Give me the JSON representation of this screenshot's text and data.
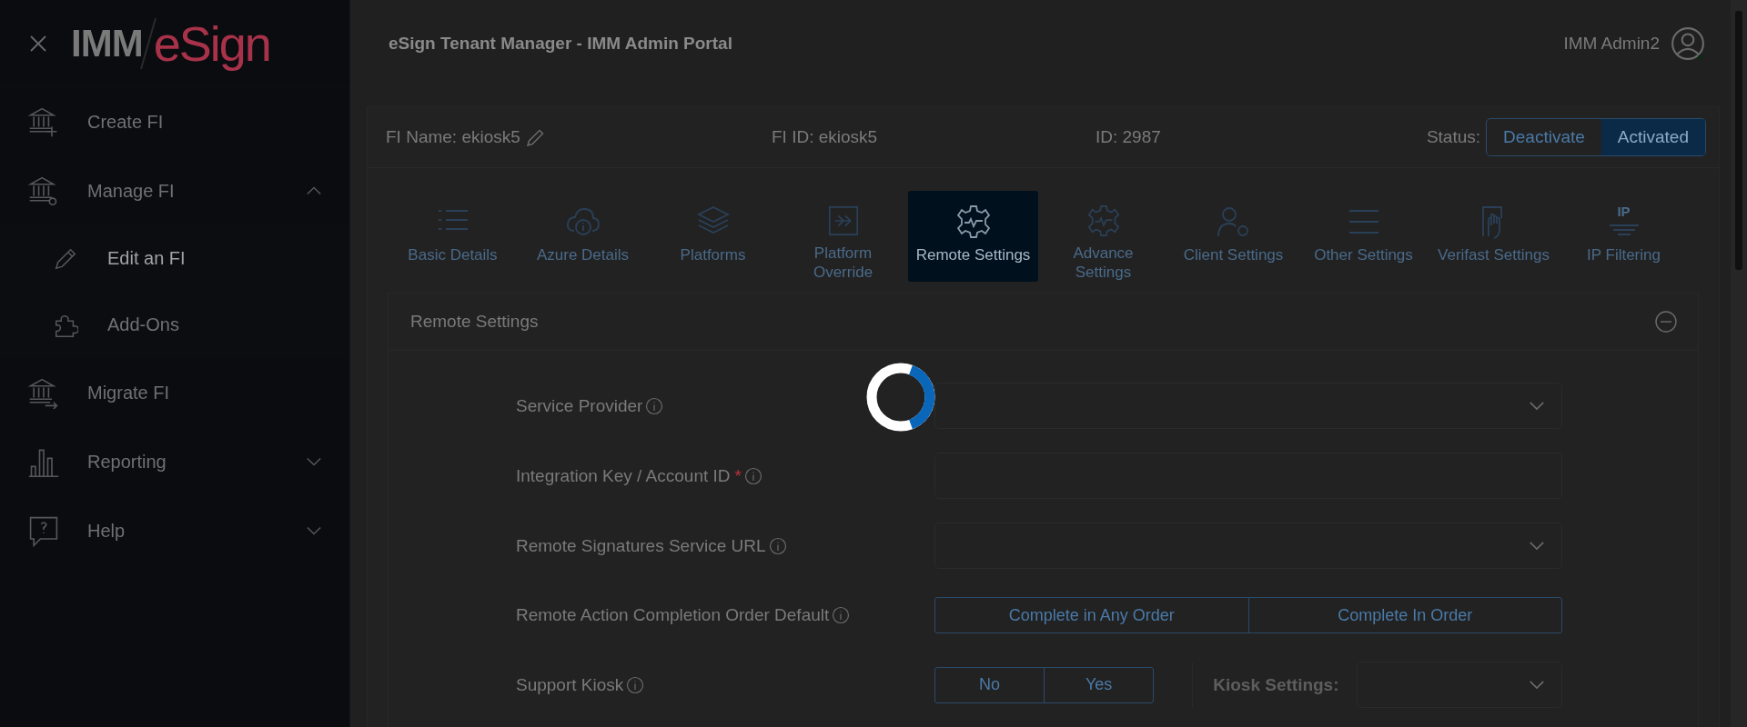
{
  "logo": {
    "left": "IMM",
    "right": "eSign"
  },
  "sidebar": {
    "items": [
      {
        "label": "Create FI",
        "selected": false
      },
      {
        "label": "Manage FI",
        "expanded": true,
        "selected": false,
        "children": [
          {
            "label": "Edit an FI",
            "selected": true
          },
          {
            "label": "Add-Ons",
            "selected": false
          }
        ]
      },
      {
        "label": "Migrate FI",
        "selected": false
      },
      {
        "label": "Reporting",
        "expanded": false,
        "selected": false
      },
      {
        "label": "Help",
        "expanded": false,
        "selected": false
      }
    ]
  },
  "header": {
    "title": "eSign Tenant Manager - IMM Admin Portal",
    "user": "IMM Admin2"
  },
  "fi_info": {
    "name_label": "FI Name: ekiosk5",
    "fi_id": "FI ID: ekiosk5",
    "id": "ID: 2987",
    "status_label": "Status:",
    "status_options": [
      {
        "label": "Deactivate",
        "selected": false
      },
      {
        "label": "Activated",
        "selected": true
      }
    ]
  },
  "tabs": [
    {
      "label": "Basic Details",
      "selected": false
    },
    {
      "label": "Azure Details",
      "selected": false
    },
    {
      "label": "Platforms",
      "selected": false
    },
    {
      "label": "Platform Override",
      "selected": false
    },
    {
      "label": "Remote Settings",
      "selected": true
    },
    {
      "label": "Advance Settings",
      "selected": false
    },
    {
      "label": "Client Settings",
      "selected": false
    },
    {
      "label": "Other Settings",
      "selected": false
    },
    {
      "label": "Verifast Settings",
      "selected": false
    },
    {
      "label": "IP Filtering",
      "selected": false,
      "icon_text": "IP"
    }
  ],
  "section": {
    "title": "Remote Settings",
    "expanded": true,
    "rows": [
      {
        "kind": "select",
        "label": "Service Provider"
      },
      {
        "kind": "input",
        "label": "Integration Key / Account ID",
        "required_mark": "*"
      },
      {
        "kind": "select",
        "label": "Remote Signatures Service URL"
      },
      {
        "kind": "toggle",
        "label": "Remote Action Completion Order Default",
        "options": [
          {
            "label": "Complete in Any Order",
            "selected": false
          },
          {
            "label": "Complete In Order",
            "selected": false
          }
        ]
      },
      {
        "kind": "toggle",
        "label": "Support Kiosk",
        "options": [
          {
            "label": "No",
            "selected": false
          },
          {
            "label": "Yes",
            "selected": false
          }
        ],
        "side": {
          "label": "Kiosk Settings:",
          "disabled": true
        }
      }
    ]
  },
  "loading": true
}
